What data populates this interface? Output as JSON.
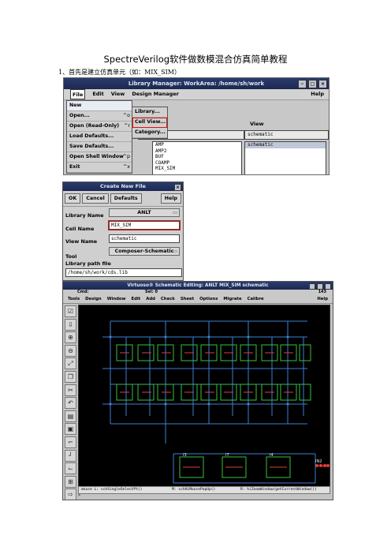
{
  "document": {
    "title": "SpectreVerilog软件做数模混合仿真简单教程",
    "step1": "1、首先是建立仿真单元（如：MIX_SIM）"
  },
  "library_manager": {
    "title": "Library Manager: WorkArea: /home/sh/work",
    "menus": [
      "File",
      "Edit",
      "View",
      "Design Manager"
    ],
    "help": "Help",
    "file_menu": [
      {
        "label": "New",
        "accel": ""
      },
      {
        "label": "Open...",
        "accel": "^o"
      },
      {
        "label": "Open (Read-Only)",
        "accel": "^r"
      },
      {
        "label": "Load Defaults...",
        "accel": ""
      },
      {
        "label": "Save Defaults...",
        "accel": ""
      },
      {
        "label": "Open Shell Window",
        "accel": "^p"
      },
      {
        "label": "Exit",
        "accel": "^x"
      }
    ],
    "new_submenu": [
      "Library...",
      "Cell View...",
      "Category..."
    ],
    "view_label": "View",
    "view_field": "schematic",
    "view_list": [
      "schematic"
    ],
    "cell_list": [
      "AMP",
      "AMP2",
      "BUF",
      "COAMP",
      "MIX_SIM"
    ]
  },
  "create_new_file": {
    "title": "Create New File",
    "buttons": {
      "ok": "OK",
      "cancel": "Cancel",
      "defaults": "Defaults",
      "help": "Help"
    },
    "library_name_label": "Library Name",
    "library_name_value": "ANLT",
    "cell_name_label": "Cell Name",
    "cell_name_value": "MIX_SIM",
    "view_name_label": "View Name",
    "view_name_value": "schematic",
    "tool_label": "Tool",
    "tool_value": "Composer-Schematic",
    "library_path_label": "Library path file",
    "library_path_value": "/home/sh/work/cds.lib"
  },
  "schematic": {
    "title": "Virtuoso® Schematic Editing: ANLT MIX_SIM schematic",
    "cmd_label": "Cmd:",
    "sel_label": "Sel: 0",
    "coord": "143",
    "menus": [
      "Tools",
      "Design",
      "Window",
      "Edit",
      "Add",
      "Check",
      "Sheet",
      "Options",
      "Migrate",
      "Calibre"
    ],
    "help": "Help",
    "mouse_left": "mouse L: schSingleSelectPt()",
    "mouse_mid": "M: schHiMousePopUp()",
    "mouse_right": "R: hiZoomWindow(getCurrentWindow())",
    "prompt": ">",
    "instance_labels": [
      "I3",
      "I7",
      "I4"
    ],
    "output_label": "IN2"
  }
}
